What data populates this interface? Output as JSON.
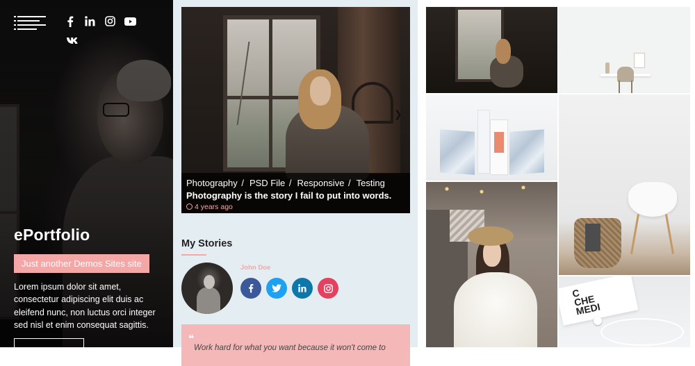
{
  "sidebar": {
    "menu_icon": "hamburger-menu-icon",
    "social_icons": [
      "facebook-icon",
      "linkedin-icon",
      "instagram-icon",
      "youtube-icon",
      "vk-icon"
    ],
    "site_title": "ePortfolio",
    "tagline": "Just another Demos Sites site",
    "description": "Lorem ipsum dolor sit amet, consectetur adipiscing elit duis ac eleifend nunc, non luctus orci integer sed nisl et enim consequat sagittis."
  },
  "featured_post": {
    "categories": [
      "Photography",
      "PSD File",
      "Responsive",
      "Testing"
    ],
    "title": "Photography is the story I fail to put into words.",
    "time": "4 years ago"
  },
  "stories": {
    "heading": "My Stories",
    "author_name": "John Doe",
    "author_socials": [
      {
        "icon": "facebook-icon",
        "color": "#3b5998"
      },
      {
        "icon": "twitter-icon",
        "color": "#1da1f2"
      },
      {
        "icon": "linkedin-icon",
        "color": "#0e76a8"
      },
      {
        "icon": "instagram-icon",
        "color": "#e4405f"
      }
    ],
    "quote": "Work hard for what you want because it won't come to"
  },
  "colors": {
    "accent": "#f4a7a7",
    "middle_bg": "#e4edf2",
    "sidebar_bg": "#111111"
  }
}
